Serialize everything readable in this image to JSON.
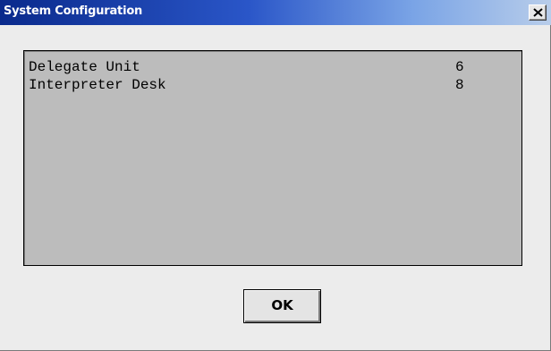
{
  "window": {
    "title": "System Configuration",
    "close_glyph": "×"
  },
  "config_list": {
    "items": [
      {
        "label": "Delegate Unit",
        "value": "6"
      },
      {
        "label": "Interpreter Desk",
        "value": "8"
      }
    ]
  },
  "buttons": {
    "ok_label": "OK"
  },
  "colors": {
    "title_bar_start": "#0a2a8c",
    "title_bar_end": "#b8cdea",
    "panel_background": "#bcbcbc",
    "window_background": "#ececec"
  },
  "icons": {
    "close": "close-icon"
  }
}
